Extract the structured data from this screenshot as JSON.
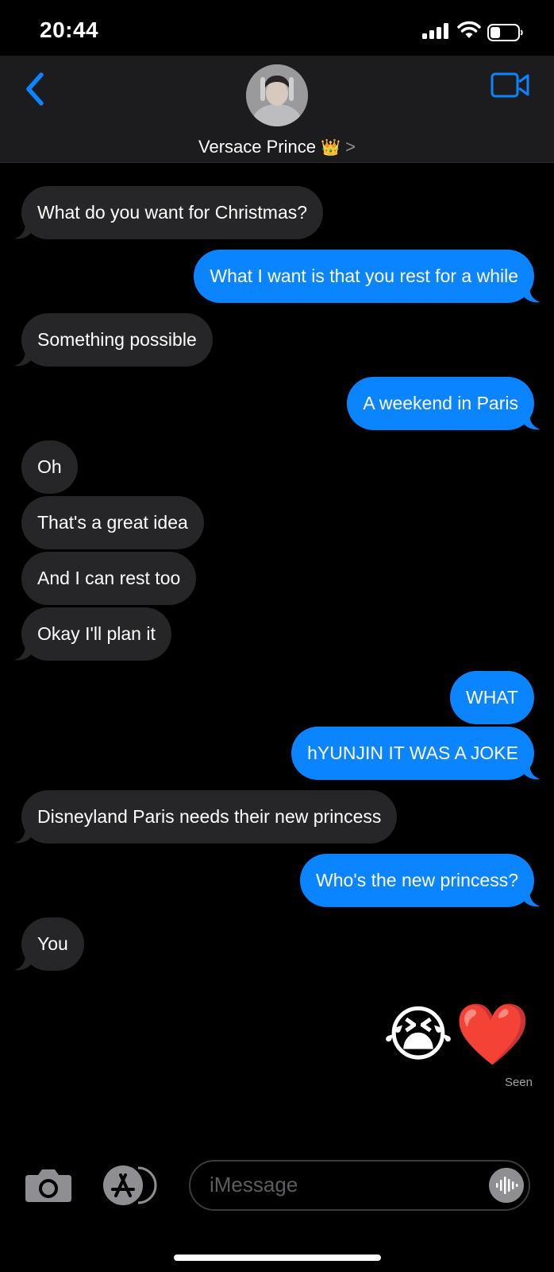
{
  "status": {
    "time": "20:44"
  },
  "header": {
    "contact_name": "Versace Prince",
    "crown": "👑",
    "chevron": ">"
  },
  "messages": [
    {
      "text": "What do you want for Christmas?",
      "side": "received"
    },
    {
      "text": "What I want is that you rest for a while",
      "side": "sent"
    },
    {
      "text": "Something possible",
      "side": "received"
    },
    {
      "text": "A weekend in Paris",
      "side": "sent"
    },
    {
      "text": "Oh",
      "side": "received"
    },
    {
      "text": "That's a great idea",
      "side": "received"
    },
    {
      "text": "And I can rest too",
      "side": "received"
    },
    {
      "text": "Okay I'll plan it",
      "side": "received"
    },
    {
      "text": "WHAT",
      "side": "sent"
    },
    {
      "text": "hYUNJIN IT WAS A JOKE",
      "side": "sent"
    },
    {
      "text": "Disneyland Paris needs their new princess",
      "side": "received"
    },
    {
      "text": "Who's the new princess?",
      "side": "sent"
    },
    {
      "text": "You",
      "side": "received"
    }
  ],
  "last_reply": {
    "emojis": "😭❤️",
    "receipt": "Seen"
  },
  "composer": {
    "placeholder": "iMessage"
  },
  "colors": {
    "sent_bubble": "#0a84ff",
    "received_bubble": "#262628",
    "accent": "#0a84ff",
    "header_bg": "#1c1c1e"
  },
  "icons": [
    "back-chevron-icon",
    "video-call-icon",
    "camera-icon",
    "app-store-icon",
    "audio-waveform-icon",
    "signal-icon",
    "wifi-icon",
    "battery-icon"
  ]
}
